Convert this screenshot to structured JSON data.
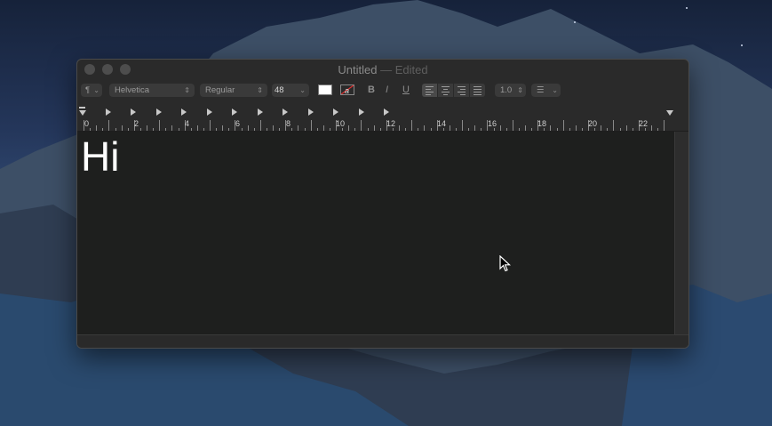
{
  "window": {
    "title": "Untitled",
    "title_suffix": "— Edited"
  },
  "toolbar": {
    "paragraph_style": "¶",
    "font_family": "Helvetica",
    "font_typeface": "Regular",
    "font_size": "48",
    "text_color": "#ffffff",
    "bold": "B",
    "italic": "I",
    "underline": "U",
    "line_spacing": "1.0",
    "list_style": "list"
  },
  "ruler": {
    "labels": [
      "0",
      "2",
      "4",
      "6",
      "8",
      "10",
      "12",
      "14",
      "16",
      "18",
      "20",
      "22"
    ]
  },
  "document": {
    "text": "Hi"
  },
  "colors": {
    "window_bg": "#2a2a2a",
    "document_bg": "#1e1f1e",
    "text": "#ffffff"
  }
}
